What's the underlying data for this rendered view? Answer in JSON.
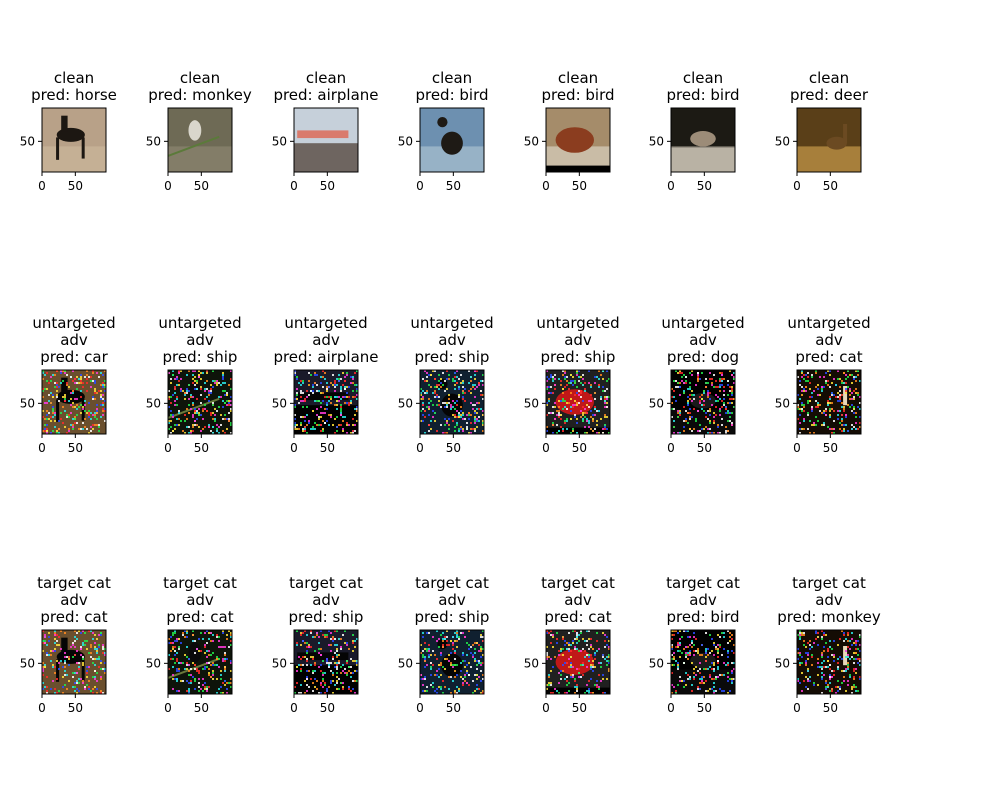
{
  "chart_data": {
    "type": "image-grid",
    "axis": {
      "extent": [
        0,
        96
      ],
      "xticks": [
        0,
        50
      ],
      "yticks": [
        50
      ],
      "xtick_labels": [
        "0",
        "50"
      ],
      "ytick_labels": [
        "50"
      ]
    },
    "rows": [
      {
        "panels": [
          {
            "title_lines": [
              "clean",
              "pred: horse"
            ],
            "scene": "horse"
          },
          {
            "title_lines": [
              "clean",
              "pred: monkey"
            ],
            "scene": "monkey"
          },
          {
            "title_lines": [
              "clean",
              "pred: airplane"
            ],
            "scene": "airplane"
          },
          {
            "title_lines": [
              "clean",
              "pred: bird"
            ],
            "scene": "duck"
          },
          {
            "title_lines": [
              "clean",
              "pred: bird"
            ],
            "scene": "hen"
          },
          {
            "title_lines": [
              "clean",
              "pred: bird"
            ],
            "scene": "sparrow"
          },
          {
            "title_lines": [
              "clean",
              "pred: deer"
            ],
            "scene": "deer"
          }
        ]
      },
      {
        "panels": [
          {
            "title_lines": [
              "untargeted",
              "adv",
              "pred: car"
            ],
            "scene": "horse"
          },
          {
            "title_lines": [
              "untargeted",
              "adv",
              "pred: ship"
            ],
            "scene": "monkey"
          },
          {
            "title_lines": [
              "untargeted",
              "adv",
              "pred: airplane"
            ],
            "scene": "airplane"
          },
          {
            "title_lines": [
              "untargeted",
              "adv",
              "pred: ship"
            ],
            "scene": "duck"
          },
          {
            "title_lines": [
              "untargeted",
              "adv",
              "pred: ship"
            ],
            "scene": "hen"
          },
          {
            "title_lines": [
              "untargeted",
              "adv",
              "pred: dog"
            ],
            "scene": "sparrow"
          },
          {
            "title_lines": [
              "untargeted",
              "adv",
              "pred: cat"
            ],
            "scene": "deer"
          }
        ]
      },
      {
        "panels": [
          {
            "title_lines": [
              "target cat",
              "adv",
              "pred: cat"
            ],
            "scene": "horse"
          },
          {
            "title_lines": [
              "target cat",
              "adv",
              "pred: cat"
            ],
            "scene": "monkey"
          },
          {
            "title_lines": [
              "target cat",
              "adv",
              "pred: ship"
            ],
            "scene": "airplane"
          },
          {
            "title_lines": [
              "target cat",
              "adv",
              "pred: ship"
            ],
            "scene": "duck"
          },
          {
            "title_lines": [
              "target cat",
              "adv",
              "pred: cat"
            ],
            "scene": "hen"
          },
          {
            "title_lines": [
              "target cat",
              "adv",
              "pred: bird"
            ],
            "scene": "sparrow"
          },
          {
            "title_lines": [
              "target cat",
              "adv",
              "pred: monkey"
            ],
            "scene": "deer"
          }
        ]
      }
    ],
    "scenes": {
      "horse": {
        "bg": "#b8a188",
        "bg2": "#cbb69b",
        "subject": "#1c1712",
        "noisy_bg": "#6a4f2e"
      },
      "monkey": {
        "bg": "#6e6a55",
        "bg2": "#8c8670",
        "subject": "#3b3a30",
        "noisy_bg": "#0e140a"
      },
      "airplane": {
        "bg": "#c6d0da",
        "bg2": "#6e6560",
        "subject": "#d97b6d",
        "noisy_bg": "#1a1a2a"
      },
      "duck": {
        "bg": "#6d90b0",
        "bg2": "#a9c0d0",
        "subject": "#1e1a15",
        "noisy_bg": "#102030"
      },
      "hen": {
        "bg": "#a58c6a",
        "bg2": "#d9d0c0",
        "subject": "#8b3d1f",
        "noisy_bg": "#202020"
      },
      "sparrow": {
        "bg": "#1c1a14",
        "bg2": "#b9b2a4",
        "subject": "#9c8c78",
        "noisy_bg": "#000000"
      },
      "deer": {
        "bg": "#5a3f18",
        "bg2": "#c89b4a",
        "subject": "#6b4a22",
        "noisy_bg": "#140c04"
      }
    },
    "noise_palette": [
      "#ff2a2a",
      "#22e84b",
      "#2a4bff",
      "#ffe23a",
      "#ff3ad9",
      "#2ae8e8",
      "#ffffff",
      "#ff8a1e"
    ]
  }
}
